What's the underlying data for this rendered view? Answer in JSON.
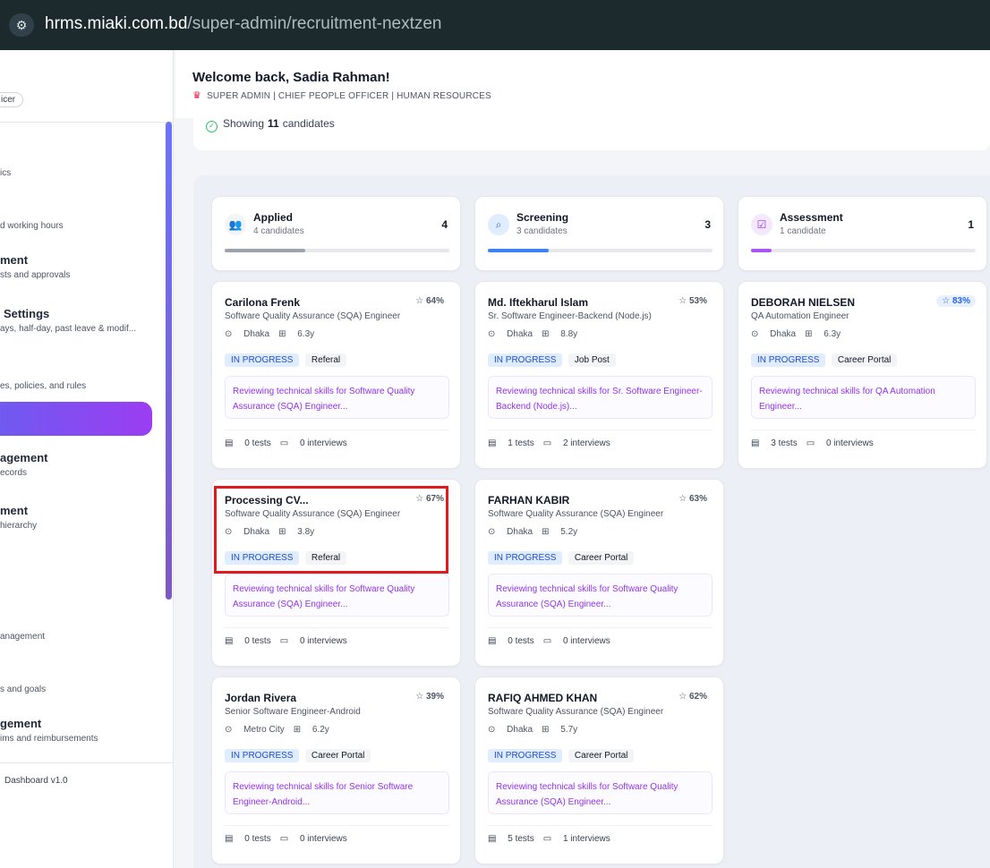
{
  "browser": {
    "url_host": "hrms.miaki.com.bd",
    "url_path": "/super-admin/recruitment-nextzen"
  },
  "sidebar": {
    "role_badge": "icer",
    "items": [
      {
        "title": "",
        "sub": "ics"
      },
      {
        "title": "",
        "sub": "d working hours"
      },
      {
        "title": "ment",
        "sub": "sts and approvals"
      },
      {
        "title": "Settings",
        "sub": "ays, half-day, past leave & modif..."
      },
      {
        "title": "",
        "sub": "es, policies, and rules"
      },
      {
        "title": "agement",
        "sub": "ecords"
      },
      {
        "title": "ment",
        "sub": "hierarchy"
      },
      {
        "title": "",
        "sub": "anagement"
      },
      {
        "title": "",
        "sub": "s and goals"
      },
      {
        "title": "gement",
        "sub": "ims and reimbursements"
      }
    ],
    "footer": "Dashboard v1.0"
  },
  "header": {
    "welcome": "Welcome back, Sadia Rahman!",
    "subtitle": "SUPER ADMIN | CHIEF PEOPLE OFFICER | HUMAN RESOURCES"
  },
  "summary": {
    "prefix": "Showing",
    "count": "11",
    "suffix": "candidates"
  },
  "columns": [
    {
      "title": "Applied",
      "count_text": "4 candidates",
      "count": "4",
      "icon": "users-icon",
      "color": "#9ca3af",
      "fill": 0.36
    },
    {
      "title": "Screening",
      "count_text": "3 candidates",
      "count": "3",
      "icon": "search-icon",
      "color": "#3b82f6",
      "fill": 0.27
    },
    {
      "title": "Assessment",
      "count_text": "1 candidate",
      "count": "1",
      "icon": "clipboard-check-icon",
      "color": "#a855f7",
      "fill": 0.09
    }
  ],
  "cards": {
    "applied": [
      {
        "name": "Carilona Frenk",
        "score": "64%",
        "role": "Software Quality Assurance (SQA) Engineer",
        "location": "Dhaka",
        "experience": "6.3y",
        "status": "IN PROGRESS",
        "source": "Referal",
        "note": "Reviewing technical skills for Software Quality Assurance (SQA) Engineer...",
        "tests": "0 tests",
        "interviews": "0 interviews"
      },
      {
        "name": "Processing CV...",
        "score": "67%",
        "role": "Software Quality Assurance (SQA) Engineer",
        "location": "Dhaka",
        "experience": "3.8y",
        "status": "IN PROGRESS",
        "source": "Referal",
        "note": "Reviewing technical skills for Software Quality Assurance (SQA) Engineer...",
        "tests": "0 tests",
        "interviews": "0 interviews"
      },
      {
        "name": "Jordan Rivera",
        "score": "39%",
        "role": "Senior Software Engineer-Android",
        "location": "Metro City",
        "experience": "6.2y",
        "status": "IN PROGRESS",
        "source": "Career Portal",
        "note": "Reviewing technical skills for Senior Software Engineer-Android...",
        "tests": "0 tests",
        "interviews": "0 interviews"
      }
    ],
    "screening": [
      {
        "name": "Md. Iftekharul Islam",
        "score": "53%",
        "role": "Sr. Software Engineer-Backend (Node.js)",
        "location": "Dhaka",
        "experience": "8.8y",
        "status": "IN PROGRESS",
        "source": "Job Post",
        "note": "Reviewing technical skills for Sr. Software Engineer-Backend (Node.js)...",
        "tests": "1 tests",
        "interviews": "2 interviews"
      },
      {
        "name": "FARHAN KABIR",
        "score": "63%",
        "role": "Software Quality Assurance (SQA) Engineer",
        "location": "Dhaka",
        "experience": "5.2y",
        "status": "IN PROGRESS",
        "source": "Career Portal",
        "note": "Reviewing technical skills for Software Quality Assurance (SQA) Engineer...",
        "tests": "0 tests",
        "interviews": "0 interviews"
      },
      {
        "name": "RAFIQ AHMED KHAN",
        "score": "62%",
        "role": "Software Quality Assurance (SQA) Engineer",
        "location": "Dhaka",
        "experience": "5.7y",
        "status": "IN PROGRESS",
        "source": "Career Portal",
        "note": "Reviewing technical skills for Software Quality Assurance (SQA) Engineer...",
        "tests": "5 tests",
        "interviews": "1 interviews"
      }
    ],
    "assessment": [
      {
        "name": "DEBORAH NIELSEN",
        "score": "83%",
        "role": "QA Automation Engineer",
        "location": "Dhaka",
        "experience": "6.3y",
        "status": "IN PROGRESS",
        "source": "Career Portal",
        "note": "Reviewing technical skills for QA Automation Engineer...",
        "tests": "3 tests",
        "interviews": "0 interviews"
      }
    ]
  }
}
